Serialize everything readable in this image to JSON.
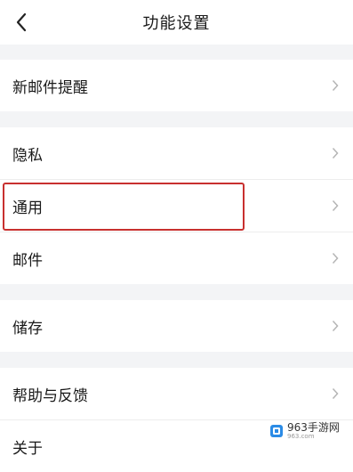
{
  "header": {
    "title": "功能设置"
  },
  "groups": [
    {
      "rows": [
        {
          "label": "新邮件提醒"
        }
      ]
    },
    {
      "rows": [
        {
          "label": "隐私"
        },
        {
          "label": "通用"
        },
        {
          "label": "邮件"
        }
      ]
    },
    {
      "rows": [
        {
          "label": "储存"
        }
      ]
    },
    {
      "rows": [
        {
          "label": "帮助与反馈"
        },
        {
          "label": "关于"
        }
      ]
    }
  ],
  "watermark": {
    "text": "963手游网",
    "sub": "963.com"
  },
  "colors": {
    "highlight": "#c8302f",
    "background": "#f3f4f6",
    "chevron": "#b5b5b5"
  },
  "icons": {
    "back": "chevron-left-icon",
    "row": "chevron-right-icon"
  }
}
